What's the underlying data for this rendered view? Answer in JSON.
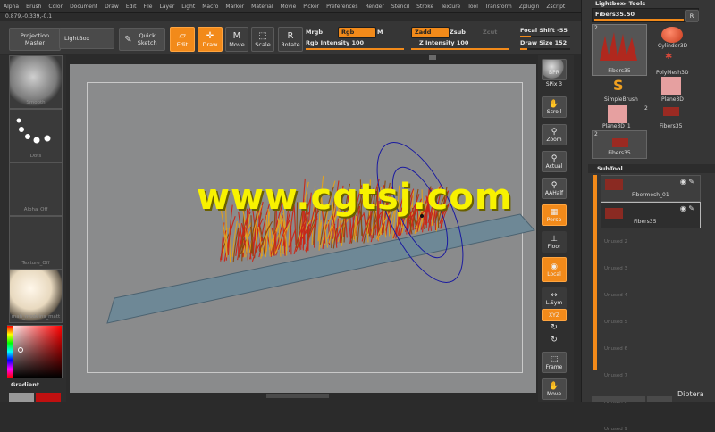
{
  "menu": [
    "Alpha",
    "Brush",
    "Color",
    "Document",
    "Draw",
    "Edit",
    "File",
    "Layer",
    "Light",
    "Macro",
    "Marker",
    "Material",
    "Movie",
    "Picker",
    "Preferences",
    "Render",
    "Stencil",
    "Stroke",
    "Texture",
    "Tool",
    "Transform",
    "Zplugin",
    "Zscript"
  ],
  "coords": "0.879,-0.339,-0.1",
  "toolbar": {
    "projection_master": "Projection Master",
    "lightbox": "LightBox",
    "quick_sketch": "Quick Sketch",
    "edit": "Edit",
    "draw": "Draw",
    "move": "Move",
    "scale": "Scale",
    "rotate": "Rotate",
    "mrgb": "Mrgb",
    "rgb": "Rgb",
    "m": "M",
    "zadd": "Zadd",
    "zsub": "Zsub",
    "zcut": "Zcut",
    "rgb_intensity_label": "Rgb Intensity",
    "rgb_intensity_value": "100",
    "z_intensity_label": "Z Intensity",
    "z_intensity_value": "100",
    "focal_shift_label": "Focal Shift",
    "focal_shift_value": "-55",
    "draw_size_label": "Draw Size",
    "draw_size_value": "152"
  },
  "left": {
    "smooth": "Smooth",
    "dots": "Dots",
    "alpha": "Alpha_Off",
    "texture": "Texture_Off",
    "material": "mah_modelns_matt",
    "gradient": "Gradient"
  },
  "shelf": {
    "bpr": "BPR",
    "spix_label": "SPix",
    "spix_value": "3",
    "scroll": "Scroll",
    "zoom": "Zoom",
    "actual": "Actual",
    "aahalf": "AAHalf",
    "persp": "Persp",
    "floor": "Floor",
    "local": "Local",
    "lsym": "L.Sym",
    "xyz": "XYZ",
    "frame": "Frame",
    "move": "Move"
  },
  "panel": {
    "title": "Lightbox▸ Tools",
    "current_tool_label": "Fibers35.",
    "current_tool_value": "50",
    "r_button": "R",
    "count_2a": "2",
    "count_2b": "2",
    "count_2c": "2",
    "tools": {
      "fibers35_a": "Fibers35",
      "cylinder": "Cylinder3D",
      "polymesh": "PolyMesh3D",
      "simplebrush": "SimpleBrush",
      "plane3d": "Plane3D",
      "plane3d_1": "Plane3D_1",
      "fibers35_b": "Fibers35",
      "fibers35_c": "Fibers35"
    },
    "subtool_title": "SubTool",
    "subtools": [
      "Fibermesh_01",
      "Fibers35"
    ],
    "unused": [
      "Unused 2",
      "Unused 3",
      "Unused 4",
      "Unused 5",
      "Unused 6",
      "Unused 7",
      "Unused 8",
      "Unused 9"
    ]
  },
  "watermark": "www.cgtsj.com",
  "corner_text": "Diptera",
  "colors": {
    "accent": "#f28a1a",
    "canvas": "#8a8b8c",
    "floor": "#6e8896",
    "watermark": "#f8f200",
    "brush_ring": "#1a1aa0"
  }
}
